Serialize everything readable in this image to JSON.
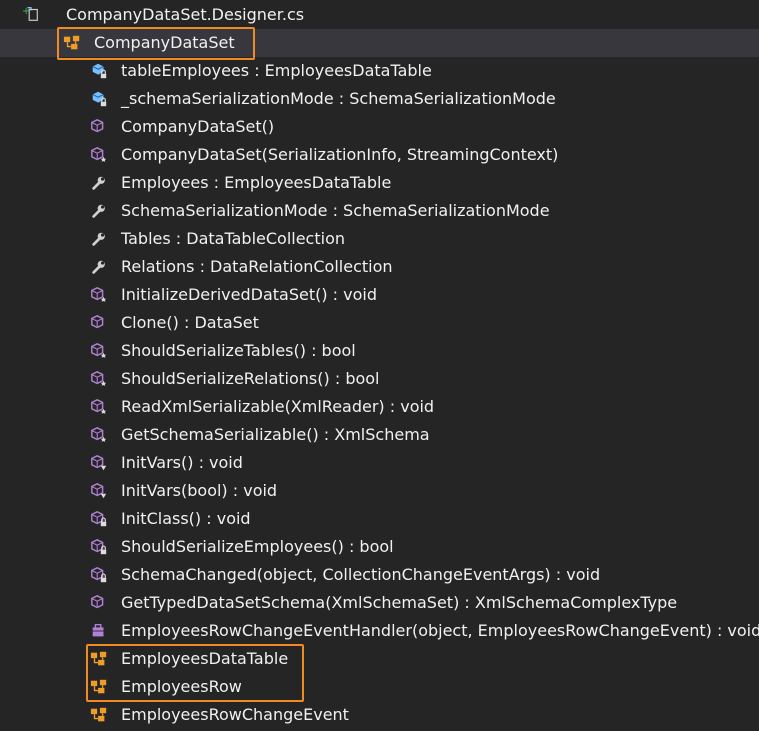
{
  "file": {
    "name": "CompanyDataSet.Designer.cs"
  },
  "class": {
    "name": "CompanyDataSet"
  },
  "members": [
    {
      "label": "tableEmployees : EmployeesDataTable",
      "icon": "field-private-icon"
    },
    {
      "label": "_schemaSerializationMode : SchemaSerializationMode",
      "icon": "field-private-icon"
    },
    {
      "label": "CompanyDataSet()",
      "icon": "method-icon"
    },
    {
      "label": "CompanyDataSet(SerializationInfo, StreamingContext)",
      "icon": "method-protected-icon"
    },
    {
      "label": "Employees : EmployeesDataTable",
      "icon": "property-icon"
    },
    {
      "label": "SchemaSerializationMode : SchemaSerializationMode",
      "icon": "property-icon"
    },
    {
      "label": "Tables : DataTableCollection",
      "icon": "property-icon"
    },
    {
      "label": "Relations : DataRelationCollection",
      "icon": "property-icon"
    },
    {
      "label": "InitializeDerivedDataSet() : void",
      "icon": "method-protected-icon"
    },
    {
      "label": "Clone() : DataSet",
      "icon": "method-icon"
    },
    {
      "label": "ShouldSerializeTables() : bool",
      "icon": "method-protected-icon"
    },
    {
      "label": "ShouldSerializeRelations() : bool",
      "icon": "method-protected-icon"
    },
    {
      "label": "ReadXmlSerializable(XmlReader) : void",
      "icon": "method-protected-icon"
    },
    {
      "label": "GetSchemaSerializable() : XmlSchema",
      "icon": "method-protected-icon"
    },
    {
      "label": "InitVars() : void",
      "icon": "method-internal-icon"
    },
    {
      "label": "InitVars(bool) : void",
      "icon": "method-internal-icon"
    },
    {
      "label": "InitClass() : void",
      "icon": "method-private-icon"
    },
    {
      "label": "ShouldSerializeEmployees() : bool",
      "icon": "method-private-icon"
    },
    {
      "label": "SchemaChanged(object, CollectionChangeEventArgs) : void",
      "icon": "method-private-icon"
    },
    {
      "label": "GetTypedDataSetSchema(XmlSchemaSet) : XmlSchemaComplexType",
      "icon": "method-icon"
    },
    {
      "label": "EmployeesRowChangeEventHandler(object, EmployeesRowChangeEvent) : void",
      "icon": "delegate-icon"
    }
  ],
  "nested_classes": [
    {
      "label": "EmployeesDataTable",
      "icon": "class-icon"
    },
    {
      "label": "EmployeesRow",
      "icon": "class-icon"
    },
    {
      "label": "EmployeesRowChangeEvent",
      "icon": "class-icon"
    }
  ],
  "colors": {
    "highlight": "#f08a24",
    "method": "#b180d7",
    "field": "#75beff",
    "class": "#ee9d28",
    "background": "#252526"
  }
}
